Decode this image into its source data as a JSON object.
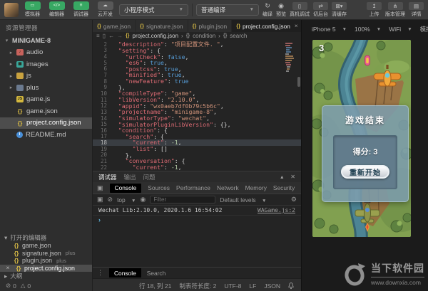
{
  "colors": {
    "accent_green": "#38a863",
    "brace_yellow": "#d7ba45",
    "key": "#e06c75",
    "string": "#ce9178",
    "bool": "#569cd6",
    "number": "#b5cea8",
    "dialog_blue": "#7c9cac"
  },
  "toolbar": {
    "tools": [
      {
        "label": "模拟器"
      },
      {
        "label": "编辑器"
      },
      {
        "label": "调试器"
      },
      {
        "label": "云开发"
      }
    ],
    "mode_select": "小程序模式",
    "compile_select": "普通编译",
    "actions": [
      {
        "label": "编译"
      },
      {
        "label": "预览"
      },
      {
        "label": "真机调试"
      },
      {
        "label": "切后台"
      },
      {
        "label": "清缓存"
      }
    ],
    "right_actions": [
      {
        "label": "上传"
      },
      {
        "label": "版本管理"
      },
      {
        "label": "详情"
      }
    ]
  },
  "sidebar": {
    "explorer_title": "资源管理器",
    "root": "MINIGAME-8",
    "tree": [
      {
        "label": "audio"
      },
      {
        "label": "images"
      },
      {
        "label": "js"
      },
      {
        "label": "plus"
      },
      {
        "label": "game.js"
      },
      {
        "label": "game.json"
      },
      {
        "label": "project.config.json"
      },
      {
        "label": "README.md"
      }
    ],
    "open_editors_title": "打开的编辑器",
    "open_editors": [
      {
        "label": "game.json",
        "suffix": ""
      },
      {
        "label": "signature.json",
        "suffix": "plus"
      },
      {
        "label": "plugin.json",
        "suffix": "plus"
      },
      {
        "label": "project.config.json",
        "suffix": ""
      }
    ],
    "outline_label": "大纲",
    "error_count": "0",
    "warning_count": "0"
  },
  "editor": {
    "tabs": [
      {
        "label": "game.json"
      },
      {
        "label": "signature.json"
      },
      {
        "label": "plugin.json"
      },
      {
        "label": "project.config.json"
      }
    ],
    "breadcrumb": {
      "file": "project.config.json",
      "level1": "condition",
      "level2": "search"
    },
    "code_lines": [
      {
        "n": "2",
        "hl": false,
        "seg": [
          [
            "k",
            "  \"description\""
          ],
          [
            "p",
            ": "
          ],
          [
            "s",
            "\"项目配置文件. \""
          ],
          [
            "p",
            ","
          ]
        ]
      },
      {
        "n": "3",
        "hl": false,
        "seg": [
          [
            "k",
            "  \"setting\""
          ],
          [
            "p",
            ": {"
          ]
        ]
      },
      {
        "n": "4",
        "hl": false,
        "seg": [
          [
            "k",
            "    \"urlCheck\""
          ],
          [
            "p",
            ": "
          ],
          [
            "b",
            "false"
          ],
          [
            "p",
            ","
          ]
        ]
      },
      {
        "n": "5",
        "hl": false,
        "seg": [
          [
            "k",
            "    \"es6\""
          ],
          [
            "p",
            ": "
          ],
          [
            "b",
            "true"
          ],
          [
            "p",
            ","
          ]
        ]
      },
      {
        "n": "6",
        "hl": false,
        "seg": [
          [
            "k",
            "    \"postcss\""
          ],
          [
            "p",
            ": "
          ],
          [
            "b",
            "true"
          ],
          [
            "p",
            ","
          ]
        ]
      },
      {
        "n": "7",
        "hl": false,
        "seg": [
          [
            "k",
            "    \"minified\""
          ],
          [
            "p",
            ": "
          ],
          [
            "b",
            "true"
          ],
          [
            "p",
            ","
          ]
        ]
      },
      {
        "n": "8",
        "hl": false,
        "seg": [
          [
            "k",
            "    \"newFeature\""
          ],
          [
            "p",
            ": "
          ],
          [
            "b",
            "true"
          ]
        ]
      },
      {
        "n": "9",
        "hl": false,
        "seg": [
          [
            "p",
            "  },"
          ]
        ]
      },
      {
        "n": "10",
        "hl": false,
        "seg": [
          [
            "k",
            "  \"compileType\""
          ],
          [
            "p",
            ": "
          ],
          [
            "s",
            "\"game\""
          ],
          [
            "p",
            ","
          ]
        ]
      },
      {
        "n": "11",
        "hl": false,
        "seg": [
          [
            "k",
            "  \"libVersion\""
          ],
          [
            "p",
            ": "
          ],
          [
            "s",
            "\"2.10.0\""
          ],
          [
            "p",
            ","
          ]
        ]
      },
      {
        "n": "12",
        "hl": false,
        "seg": [
          [
            "k",
            "  \"appid\""
          ],
          [
            "p",
            ": "
          ],
          [
            "s",
            "\"wx0aeb7df0b79c5b6c\""
          ],
          [
            "p",
            ","
          ]
        ]
      },
      {
        "n": "13",
        "hl": false,
        "seg": [
          [
            "k",
            "  \"projectname\""
          ],
          [
            "p",
            ": "
          ],
          [
            "s",
            "\"minigame-8\""
          ],
          [
            "p",
            ","
          ]
        ]
      },
      {
        "n": "14",
        "hl": false,
        "seg": [
          [
            "k",
            "  \"simulatorType\""
          ],
          [
            "p",
            ": "
          ],
          [
            "s",
            "\"wechat\""
          ],
          [
            "p",
            ","
          ]
        ]
      },
      {
        "n": "15",
        "hl": false,
        "seg": [
          [
            "k",
            "  \"simulatorPluginLibVersion\""
          ],
          [
            "p",
            ": {},"
          ]
        ]
      },
      {
        "n": "16",
        "hl": false,
        "seg": [
          [
            "k",
            "  \"condition\""
          ],
          [
            "p",
            ": {"
          ]
        ]
      },
      {
        "n": "17",
        "hl": false,
        "seg": [
          [
            "k",
            "    \"search\""
          ],
          [
            "p",
            ": {"
          ]
        ]
      },
      {
        "n": "18",
        "hl": true,
        "seg": [
          [
            "k",
            "      \"current\""
          ],
          [
            "p",
            ": "
          ],
          [
            "n2",
            "-1"
          ],
          [
            "p",
            ","
          ]
        ]
      },
      {
        "n": "19",
        "hl": false,
        "seg": [
          [
            "k",
            "      \"list\""
          ],
          [
            "p",
            ": []"
          ]
        ]
      },
      {
        "n": "20",
        "hl": false,
        "seg": [
          [
            "p",
            "    },"
          ]
        ]
      },
      {
        "n": "21",
        "hl": false,
        "seg": [
          [
            "k",
            "    \"conversation\""
          ],
          [
            "p",
            ": {"
          ]
        ]
      },
      {
        "n": "22",
        "hl": false,
        "seg": [
          [
            "k",
            "      \"current\""
          ],
          [
            "p",
            ": "
          ],
          [
            "n2",
            "-1"
          ],
          [
            "p",
            ","
          ]
        ]
      }
    ]
  },
  "debugger": {
    "panel_tabs": [
      {
        "label": "调试器"
      },
      {
        "label": "输出"
      },
      {
        "label": "问题"
      }
    ],
    "devtools_tabs": [
      {
        "label": "Console"
      },
      {
        "label": "Sources"
      },
      {
        "label": "Performance"
      },
      {
        "label": "Network"
      },
      {
        "label": "Memory"
      },
      {
        "label": "Security"
      }
    ],
    "more_symbol": "»",
    "context_select": "top",
    "filter_placeholder": "Filter",
    "levels_select": "Default levels",
    "log_text": "Wechat Lib:2.10.0, 2020.1.6 16:54:02",
    "log_source": "WAGame.js:2",
    "prompt": "›",
    "drawer_tabs": [
      {
        "label": "Console"
      },
      {
        "label": "Search"
      }
    ]
  },
  "statusbar": {
    "cursor": "行 18, 列 21",
    "tab_size": "制表符长度: 2",
    "encoding": "UTF-8",
    "eol": "LF",
    "language": "JSON"
  },
  "simulator": {
    "device": "iPhone 5",
    "zoom": "100%",
    "network": "WiFi",
    "sim_menu": "模拟操作",
    "game": {
      "score_hud": "3",
      "dialog_title": "游戏结束",
      "score_label": "得分: 3",
      "restart_label": "重新开始"
    }
  },
  "watermark": {
    "title": "当下软件园",
    "url": "www.downxia.com"
  }
}
